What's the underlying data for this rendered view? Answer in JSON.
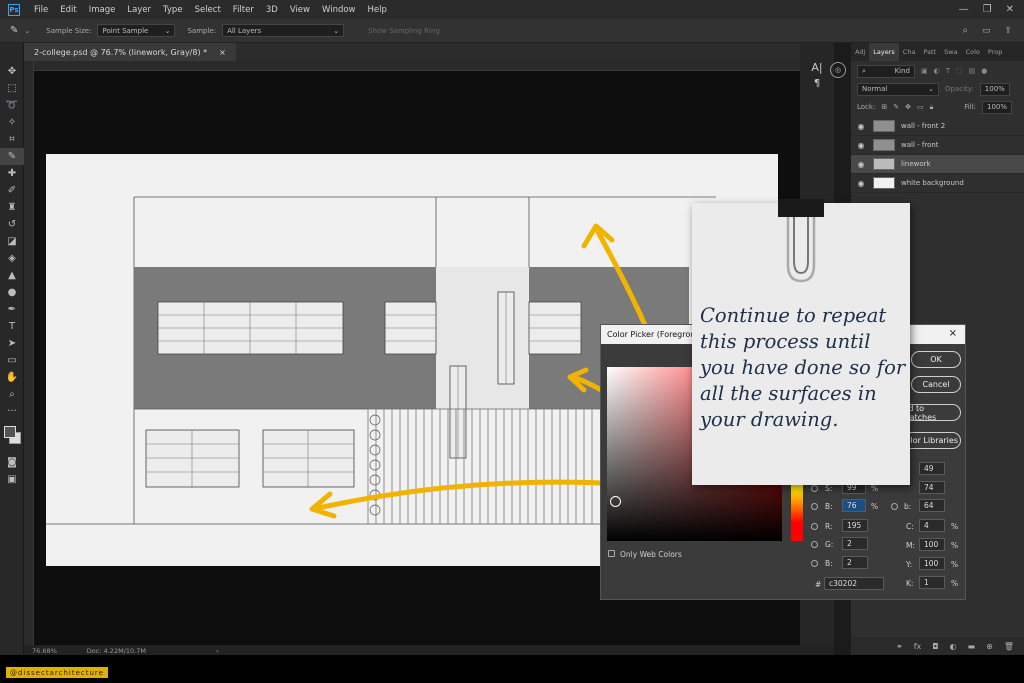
{
  "menu": {
    "app_logo": "Ps",
    "items": [
      "File",
      "Edit",
      "Image",
      "Layer",
      "Type",
      "Select",
      "Filter",
      "3D",
      "View",
      "Window",
      "Help"
    ]
  },
  "options": {
    "sample_size_label": "Sample Size:",
    "sample_size_value": "Point Sample",
    "sample_label": "Sample:",
    "sample_value": "All Layers",
    "show_ring_label": "Show Sampling Ring"
  },
  "document_tab": {
    "title": "2-college.psd @ 76.7% (linework, Gray/8) *",
    "close": "×"
  },
  "status": {
    "zoom": "76.68%",
    "doc": "Doc: 4.22M/10.7M"
  },
  "layers_panel": {
    "tabs": [
      "Adj",
      "Layers",
      "Cha",
      "Patt",
      "Swa",
      "Colo",
      "Prop"
    ],
    "search_placeholder": "Kind",
    "blend_mode": "Normal",
    "opacity_label": "Opacity:",
    "opacity_value": "100%",
    "lock_label": "Lock:",
    "fill_label": "Fill:",
    "fill_value": "100%",
    "layers": [
      {
        "name": "wall - front 2"
      },
      {
        "name": "wall - front"
      },
      {
        "name": "linework"
      },
      {
        "name": "white background"
      }
    ]
  },
  "color_picker": {
    "title": "Color Picker (Foreground Color)",
    "close": "×",
    "ok_label": "OK",
    "cancel_label": "Cancel",
    "add_swatches_label": "Add to Swatches",
    "libraries_label": "Color Libraries",
    "only_web_colors": "Only Web Colors",
    "h_value": "",
    "s_label": "S:",
    "s_value": "99",
    "b_label": "B:",
    "b_value": "76",
    "r_label": "R:",
    "r_value": "195",
    "g_label": "G:",
    "g_value": "2",
    "bb_label": "B:",
    "bb_value": "2",
    "l_value": "49",
    "a_value": "74",
    "lab_b_label": "b:",
    "lab_b_value": "64",
    "c_label": "C:",
    "c_value": "4",
    "m_label": "M:",
    "m_value": "100",
    "y_label": "Y:",
    "y_value": "100",
    "k_label": "K:",
    "k_value": "1",
    "pct": "%",
    "hash": "#",
    "hex_value": "c30202"
  },
  "note": {
    "text": "Continue to repeat this process until you have done so for all the surfaces in your drawing."
  },
  "credit": "@dissectarchitecture",
  "colors": {
    "accent_arrow": "#f0b400",
    "picked_color": "#c30202",
    "note_text": "#20304a"
  }
}
